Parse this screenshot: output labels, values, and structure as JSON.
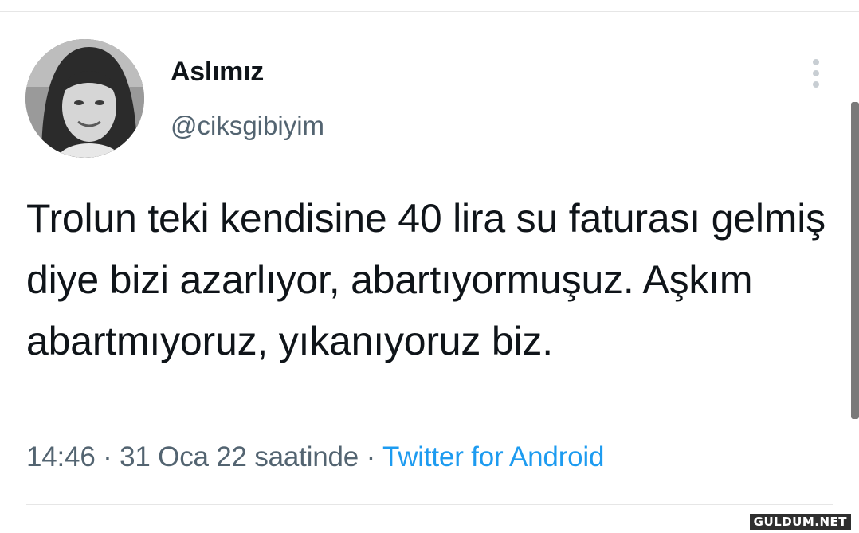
{
  "tweet": {
    "author_name": "Aslımız",
    "author_handle": "@ciksgibiyim",
    "more_icon": "more-vertical-icon",
    "text": "Trolun teki kendisine 40 lira su faturası gelmiş diye bizi azarlıyor, abartıyormuşuz. Aşkım abartmıyoruz, yıkanıyoruz biz.",
    "time": "14:46",
    "date": "31 Oca 22 saatinde",
    "separator": "·",
    "source": "Twitter for Android"
  },
  "watermark": "GULDUM.NET",
  "colors": {
    "text_primary": "#0f1419",
    "text_secondary": "#536471",
    "link": "#1d9bf0",
    "divider": "#e6e6e6"
  }
}
